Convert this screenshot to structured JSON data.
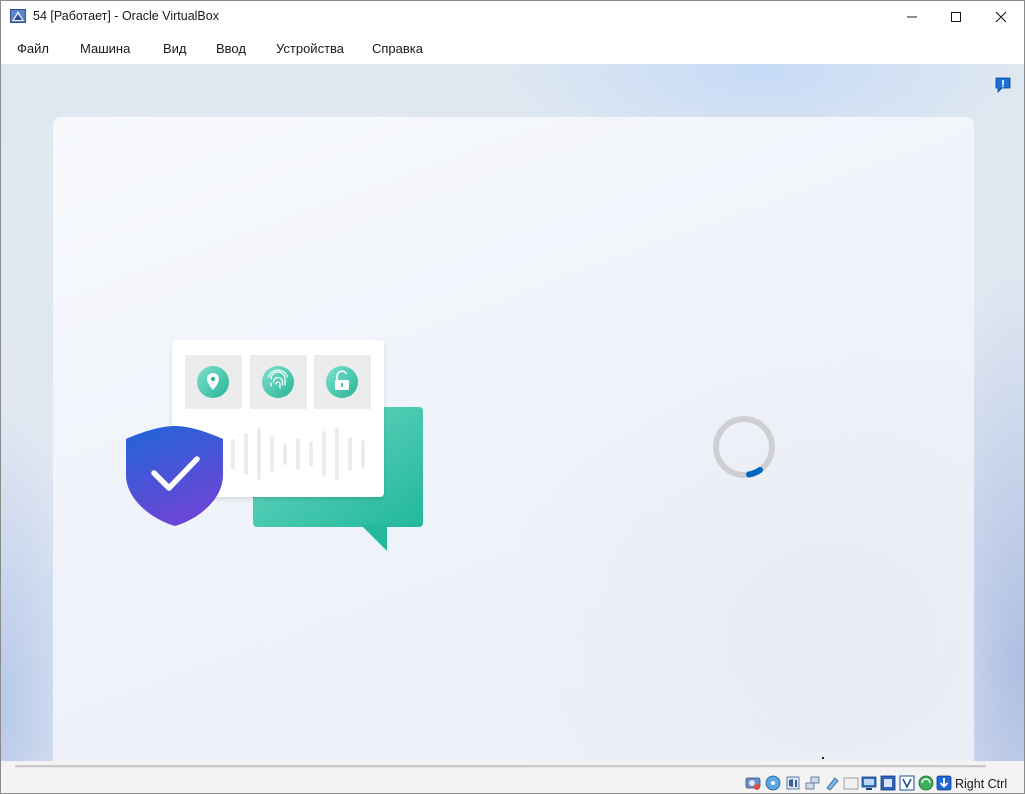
{
  "window": {
    "title": "54 [Работает] - Oracle VirtualBox"
  },
  "window_controls": [
    "minimize-icon",
    "maximize-icon",
    "close-icon"
  ],
  "menubar": {
    "items": [
      {
        "label": "Файл"
      },
      {
        "label": "Машина"
      },
      {
        "label": "Вид"
      },
      {
        "label": "Ввод"
      },
      {
        "label": "Устройства"
      },
      {
        "label": "Справка"
      }
    ]
  },
  "guest_screen": {
    "notification_icon": "notification-icon",
    "illustration_icons": [
      "location-pin-icon",
      "fingerprint-icon",
      "unlock-icon",
      "shield-check-icon",
      "chat-bubble-icon"
    ],
    "loading": true
  },
  "statusbar": {
    "device_icons": [
      "hard-disk-icon",
      "optical-drive-icon",
      "audio-icon",
      "network-icon",
      "usb-icon",
      "shared-folders-icon",
      "display-icon",
      "video-capture-icon",
      "virtualization-icon",
      "mouse-integration-icon",
      "keyboard-capture-icon"
    ],
    "host_key": "Right Ctrl"
  },
  "colors": {
    "accent": "#0067c0",
    "shield": "#3b55d9",
    "teal": "#2ec4a8"
  }
}
